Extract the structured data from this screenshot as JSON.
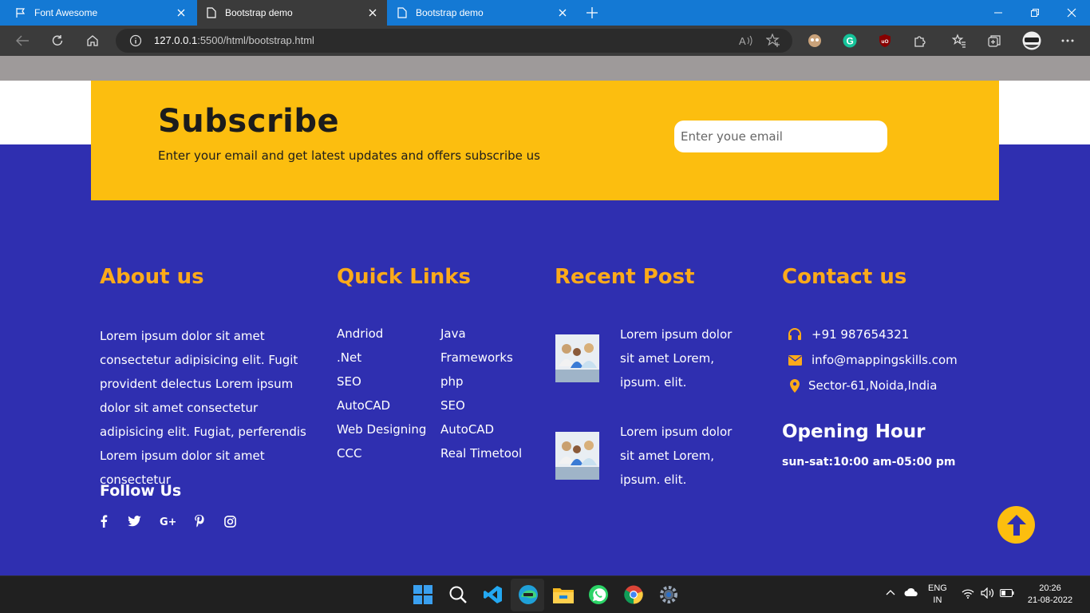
{
  "browser": {
    "tabs": [
      {
        "title": "Font Awesome",
        "icon": "flag-icon",
        "active": false
      },
      {
        "title": "Bootstrap demo",
        "icon": "page-icon",
        "active": true
      },
      {
        "title": "Bootstrap demo",
        "icon": "page-icon",
        "active": false
      }
    ],
    "url_host": "127.0.0.1",
    "url_rest": ":5500/html/bootstrap.html"
  },
  "subscribe": {
    "title": "Subscribe",
    "text": "Enter your email and get latest updates and offers subscribe us",
    "email_placeholder": "Enter youe email"
  },
  "about": {
    "heading": "About us",
    "text": "Lorem ipsum dolor sit amet consectetur adipisicing elit. Fugit provident delectus Lorem ipsum dolor sit amet consectetur adipisicing elit. Fugiat, perferendis Lorem ipsum dolor sit amet consectetur",
    "follow": "Follow Us"
  },
  "quick_links": {
    "heading": "Quick Links",
    "col1": [
      "Andriod",
      ".Net",
      "SEO",
      "AutoCAD",
      "Web Designing",
      "CCC"
    ],
    "col2": [
      "Java",
      "Frameworks",
      "php",
      "SEO",
      "AutoCAD",
      "Real Timetool"
    ]
  },
  "recent_post": {
    "heading": "Recent Post",
    "posts": [
      {
        "text": "Lorem ipsum dolor sit amet Lorem, ipsum. elit."
      },
      {
        "text": "Lorem ipsum dolor sit amet Lorem, ipsum. elit."
      }
    ]
  },
  "contact": {
    "heading": "Contact us",
    "phone": "+91 987654321",
    "email": "info@mappingskills.com",
    "address": "Sector-61,Noida,India",
    "opening_heading": "Opening Hour",
    "opening_time": "sun-sat:10:00 am-05:00 pm"
  },
  "taskbar": {
    "lang_top": "ENG",
    "lang_bottom": "IN",
    "time": "20:26",
    "date": "21-08-2022"
  },
  "colors": {
    "accent": "#fcbe0f",
    "heading_orange": "#fcaa1a",
    "footer_bg": "#2f2fb0",
    "browser_blue": "#1479d4"
  }
}
